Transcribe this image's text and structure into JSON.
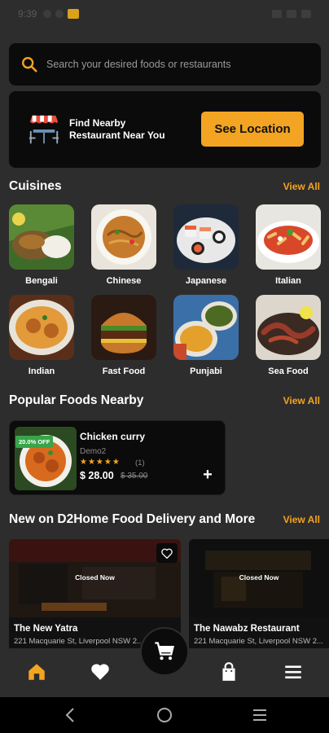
{
  "status_bar": {
    "time": "9:39"
  },
  "search": {
    "placeholder": "Search your desired foods or restaurants",
    "icon": "search-icon"
  },
  "nearby_banner": {
    "text": "Find Nearby Restaurant Near You",
    "button_label": "See Location",
    "icon": "restaurant-icon"
  },
  "cuisines": {
    "title": "Cuisines",
    "view_all": "View All",
    "items": [
      {
        "label": "Bengali"
      },
      {
        "label": "Chinese"
      },
      {
        "label": "Japanese"
      },
      {
        "label": "Italian"
      },
      {
        "label": "Indian"
      },
      {
        "label": "Fast Food"
      },
      {
        "label": "Punjabi"
      },
      {
        "label": "Sea Food"
      }
    ]
  },
  "popular": {
    "title": "Popular Foods Nearby",
    "view_all": "View All",
    "items": [
      {
        "badge": "20.0% OFF",
        "name": "Chicken curry",
        "restaurant": "Demo2",
        "stars": "★★★★★",
        "rating_count": "(1)",
        "price": "$ 28.00",
        "old_price": "$ 35.00",
        "add_label": "+"
      }
    ]
  },
  "new_on": {
    "title": "New on D2Home Food Delivery and More",
    "view_all": "View All",
    "restaurants": [
      {
        "status": "Closed Now",
        "name": "The New Yatra",
        "address": "221 Macquarie St, Liverpool NSW 2..."
      },
      {
        "status": "Closed Now",
        "name": "The Nawabz Restaurant",
        "address": "221 Macquarie St, Liverpool NSW 2..."
      }
    ]
  },
  "bottom_nav": {
    "items": [
      "home-icon",
      "heart-icon",
      "cart-icon",
      "bag-icon",
      "menu-icon"
    ],
    "active": "home-icon"
  },
  "colors": {
    "accent": "#f3a422",
    "background": "#2d2d2d",
    "card": "#0b0b0b",
    "badge": "#38a54a"
  }
}
